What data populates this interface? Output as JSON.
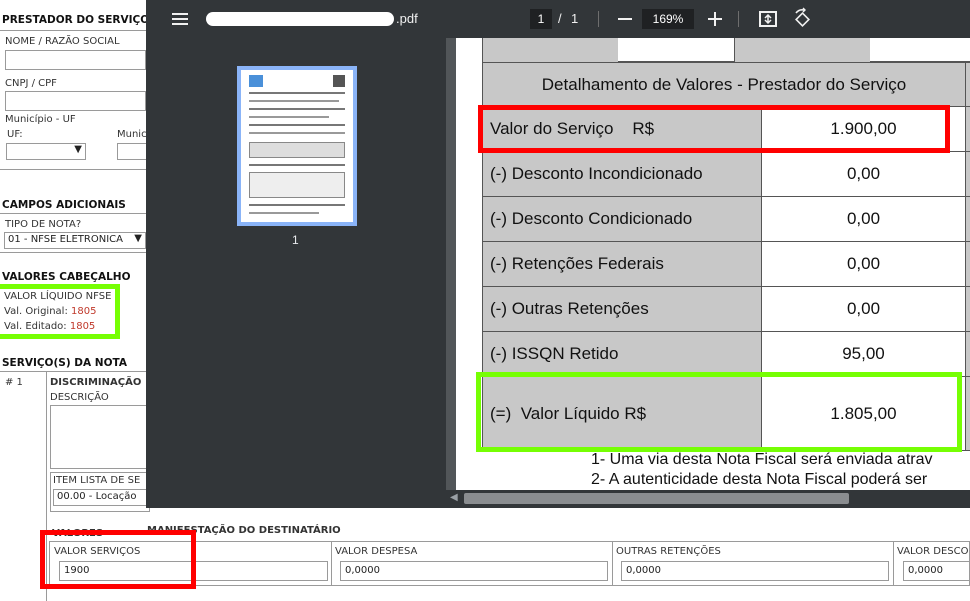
{
  "form": {
    "prestador_title": "PRESTADOR DO SERVIÇO",
    "nome_label": "NOME / RAZÃO SOCIAL",
    "cnpj_label": "CNPJ / CPF",
    "municipio_label": "Município - UF",
    "uf_label": "UF:",
    "municipio_short_label": "Munic",
    "campos_title": "CAMPOS ADICIONAIS",
    "tipo_nota_label": "TIPO DE NOTA?",
    "tipo_nota_value": "01 - NFSE ELETRONICA",
    "valores_cab_title": "VALORES CABEÇALHO",
    "valor_liquido_label": "VALOR LÍQUIDO NFSE",
    "val_original_label": "Val. Original:",
    "val_original_value": "1805",
    "val_editado_label": "Val. Editado:",
    "val_editado_value": "1805",
    "servicos_title": "SERVIÇO(S) DA NOTA",
    "item_number": "# 1",
    "discriminacao_label": "DISCRIMINAÇÃO",
    "descricao_label": "DESCRIÇÃO",
    "item_lista_label": "ITEM LISTA DE SE",
    "item_lista_value": "00.00 - Locação",
    "manifestacao_title": "MANIFESTAÇÃO DO DESTINATÁRIO",
    "valores_title": "VALORES",
    "valor_servicos_label": "VALOR SERVIÇOS",
    "valor_servicos_value": "1900",
    "valor_despesa_label": "VALOR DESPESA",
    "valor_despesa_value": "0,0000",
    "outras_retencoes_label": "OUTRAS RETENÇÕES",
    "outras_retencoes_value": "0,0000",
    "valor_desconto_label": "VALOR DESCO",
    "valor_desconto_value": "0,0000"
  },
  "viewer": {
    "file_ext": ".pdf",
    "page_current": "1",
    "page_sep": "/",
    "page_total": "1",
    "zoom": "169%",
    "thumb_label": "1",
    "icons": {
      "menu": "menu-icon",
      "zoom_out": "minus-icon",
      "zoom_in": "plus-icon",
      "fit": "fit-page-icon",
      "rotate": "rotate-icon"
    }
  },
  "pdf": {
    "table_title": "Detalhamento de Valores - Prestador do Serviço",
    "rows": [
      {
        "label": "Valor do Serviço    R$",
        "value": "1.900,00"
      },
      {
        "label": "(-) Desconto Incondicionado",
        "value": "0,00"
      },
      {
        "label": "(-) Desconto Condicionado",
        "value": "0,00"
      },
      {
        "label": "(-) Retenções Federais",
        "value": "0,00"
      },
      {
        "label": "(-) Outras Retenções",
        "value": "0,00"
      },
      {
        "label": "(-) ISSQN Retido",
        "value": "95,00"
      },
      {
        "label": "(=)  Valor Líquido R$",
        "value": "1.805,00"
      }
    ],
    "note1": "1- Uma via desta Nota Fiscal será enviada atrav",
    "note2": "2- A autenticidade desta Nota Fiscal poderá ser"
  },
  "colors": {
    "highlight_red": "#ff0000",
    "highlight_green": "#76ff03",
    "toolbar_bg": "#323639",
    "table_gray": "#c8c8c8"
  }
}
